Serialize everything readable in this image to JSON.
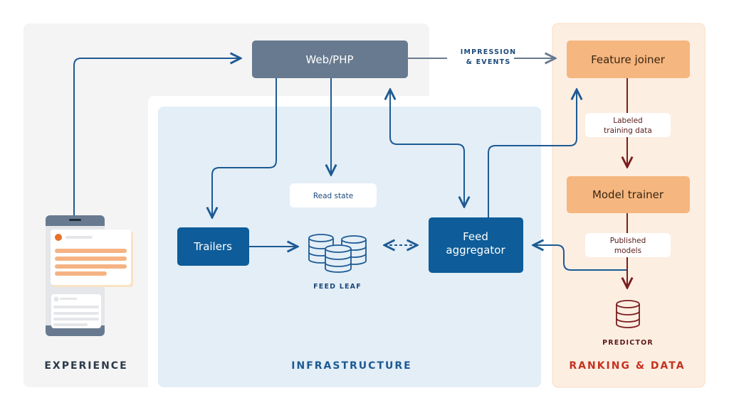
{
  "sections": {
    "experience": "EXPERIENCE",
    "infrastructure": "INFRASTRUCTURE",
    "ranking": "RANKING & DATA"
  },
  "nodes": {
    "web_php": "Web/PHP",
    "trailers": "Trailers",
    "feed_aggregator_line1": "Feed",
    "feed_aggregator_line2": "aggregator",
    "feature_joiner": "Feature joiner",
    "model_trainer": "Model trainer",
    "feed_leaf": "FEED LEAF",
    "predictor": "PREDICTOR"
  },
  "labels": {
    "impression_line1": "IMPRESSION",
    "impression_line2": "& EVENTS",
    "read_state": "Read state",
    "labeled_line1": "Labeled",
    "labeled_line2": "training data",
    "published_line1": "Published",
    "published_line2": "models"
  },
  "colors": {
    "infra_blue": "#0e5c99",
    "web_gray": "#687a8f",
    "ranking_orange": "#f5b67f",
    "ranking_text": "#c4321f",
    "arrow_red": "#7a1d1d"
  }
}
